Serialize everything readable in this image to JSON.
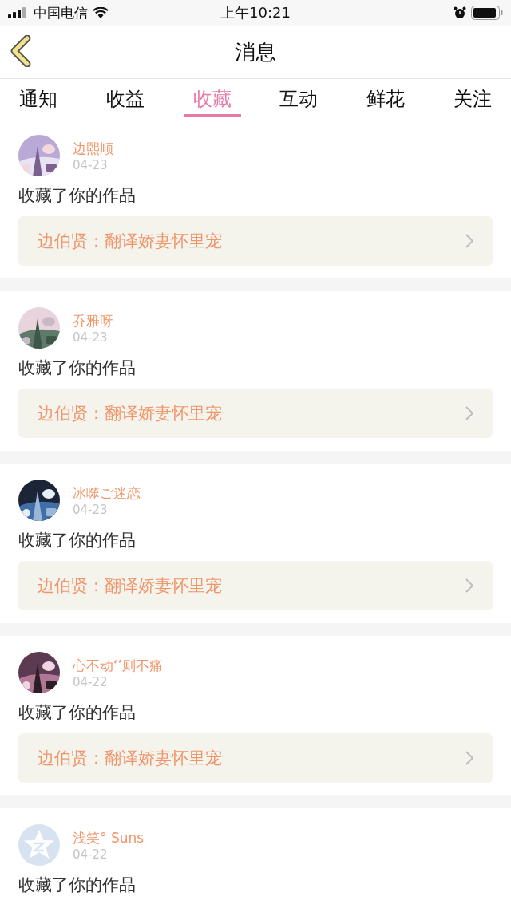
{
  "status_bar": {
    "carrier": "中国电信",
    "time": "上午10:21"
  },
  "nav": {
    "title": "消息"
  },
  "tabs": [
    {
      "label": "通知",
      "selected": false
    },
    {
      "label": "收益",
      "selected": false
    },
    {
      "label": "收藏",
      "selected": true
    },
    {
      "label": "互动",
      "selected": false
    },
    {
      "label": "鲜花",
      "selected": false
    },
    {
      "label": "关注",
      "selected": false
    }
  ],
  "messages": [
    {
      "user": "边熙顺",
      "date": "04-23",
      "text": "收藏了你的作品",
      "work": "边伯贤：翻译娇妻怀里宠"
    },
    {
      "user": "乔雅呀",
      "date": "04-23",
      "text": "收藏了你的作品",
      "work": "边伯贤：翻译娇妻怀里宠"
    },
    {
      "user": "冰噬ご迷恋",
      "date": "04-23",
      "text": "收藏了你的作品",
      "work": "边伯贤：翻译娇妻怀里宠"
    },
    {
      "user": "心不动‘’则不痛",
      "date": "04-22",
      "text": "收藏了你的作品",
      "work": "边伯贤：翻译娇妻怀里宠"
    },
    {
      "user": "浅笑° Suns",
      "date": "04-22",
      "avatar": {
        "kind": "default"
      },
      "text": "收藏了你的作品"
    }
  ]
}
